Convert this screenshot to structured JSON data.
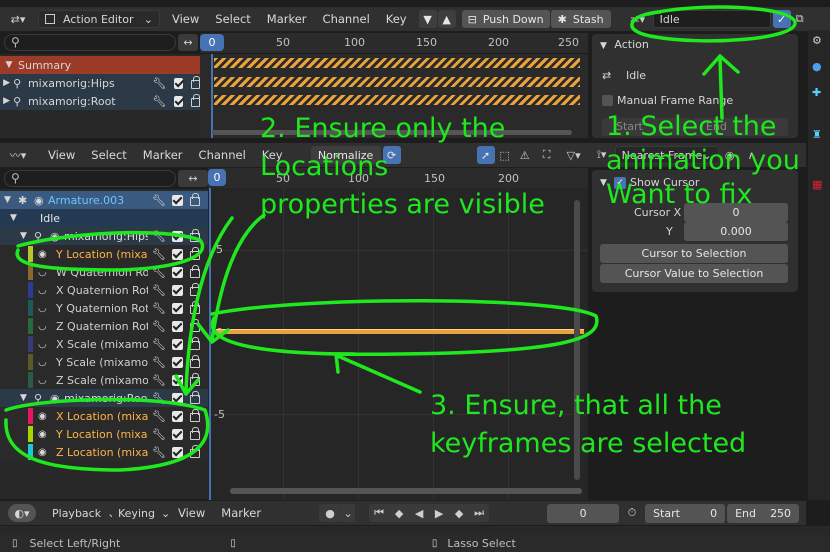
{
  "top_editor": {
    "editor_mode": "Action Editor",
    "menus": [
      "View",
      "Select",
      "Marker",
      "Channel",
      "Key"
    ],
    "push_down": "Push Down",
    "stash": "Stash",
    "action_name": "Idle",
    "current_frame": "0",
    "ticks": [
      "0",
      "50",
      "100",
      "150",
      "200",
      "250"
    ],
    "channels": [
      "Summary",
      "mixamorig:Hips",
      "mixamorig:Root"
    ]
  },
  "action_panel": {
    "title": "Action",
    "name": "Idle",
    "manual_frame_range": "Manual Frame Range",
    "start_label": "Start",
    "end_label": "End"
  },
  "graph_editor": {
    "menus": [
      "View",
      "Select",
      "Marker",
      "Channel",
      "Key"
    ],
    "normalize": "Normalize",
    "snap_mode": "Nearest Frame",
    "current_frame": "0",
    "ticks": [
      "0",
      "50",
      "100",
      "150",
      "200"
    ],
    "y_ticks": [
      "5",
      "0",
      "-5"
    ],
    "channels": [
      {
        "label": "Armature.003",
        "level": 0,
        "color": "#6cc6ff"
      },
      {
        "label": "Idle",
        "level": 1,
        "color": "#e6e6e6"
      },
      {
        "label": "mixamorig:Hips",
        "level": 2,
        "color": "#dcdcdc"
      },
      {
        "label": "Y Location (mixamo",
        "level": 3,
        "color": "#ffb347",
        "swatch": "#b5c630"
      },
      {
        "label": "W Quaternion Rotat",
        "level": 3,
        "color": "#cfcfcf",
        "swatch": "#8a6a2a"
      },
      {
        "label": "X Quaternion Rotati",
        "level": 3,
        "color": "#cfcfcf",
        "swatch": "#2b3d8c"
      },
      {
        "label": "Y Quaternion Rotati",
        "level": 3,
        "color": "#cfcfcf",
        "swatch": "#1f5a5a"
      },
      {
        "label": "Z Quaternion Rotati",
        "level": 3,
        "color": "#cfcfcf",
        "swatch": "#2a6a3a"
      },
      {
        "label": "X Scale (mixamorig",
        "level": 3,
        "color": "#cfcfcf",
        "swatch": "#3a3a7a"
      },
      {
        "label": "Y Scale (mixamorig",
        "level": 3,
        "color": "#cfcfcf",
        "swatch": "#5a5a2a"
      },
      {
        "label": "Z Scale (mixamorig",
        "level": 3,
        "color": "#cfcfcf",
        "swatch": "#2a5a4a"
      },
      {
        "label": "mixamorig:Root",
        "level": 2,
        "color": "#dcdcdc"
      },
      {
        "label": "X Location (mixam",
        "level": 3,
        "color": "#ffb347",
        "swatch": "#e8175d"
      },
      {
        "label": "Y Location (mixam",
        "level": 3,
        "color": "#ffb347",
        "swatch": "#a8d400"
      },
      {
        "label": "Z Location (mixam",
        "level": 3,
        "color": "#ffb347",
        "swatch": "#18c9d6"
      }
    ]
  },
  "view_panel": {
    "show_cursor": "Show Cursor",
    "cursor_x_label": "Cursor X",
    "cursor_x_value": "0",
    "y_label": "Y",
    "y_value": "0.000",
    "cursor_to_selection": "Cursor to Selection",
    "cursor_value_to_selection": "Cursor Value to Selection"
  },
  "timeline": {
    "playback": "Playback",
    "keying": "Keying",
    "view": "View",
    "marker": "Marker",
    "current_frame": "0",
    "start_label": "Start",
    "start_value": "0",
    "end_label": "End",
    "end_value": "250"
  },
  "status_bar": {
    "left": "Select Left/Right",
    "right": "Lasso Select"
  },
  "annotations": {
    "step1": [
      "1. Select the",
      "animation you",
      "Want to fix"
    ],
    "step2": [
      "2. Ensure only the",
      "Locations",
      "properties are visible"
    ],
    "step3": [
      "3. Ensure, that all the",
      "keyframes are selected"
    ]
  },
  "colors": {
    "accent": "#4772b3",
    "annotation": "#1fe81f",
    "keyframe": "#e8a33c"
  }
}
